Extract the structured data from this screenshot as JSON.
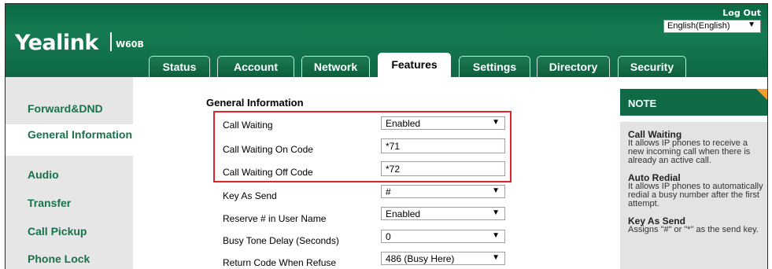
{
  "header": {
    "brand": "Yealink",
    "model": "W60B",
    "logout": "Log Out",
    "language": "English(English)"
  },
  "tabs": [
    {
      "label": "Status"
    },
    {
      "label": "Account"
    },
    {
      "label": "Network"
    },
    {
      "label": "Features"
    },
    {
      "label": "Settings"
    },
    {
      "label": "Directory"
    },
    {
      "label": "Security"
    }
  ],
  "sidebar": {
    "items": [
      {
        "label": "Forward&DND"
      },
      {
        "label": "General Information"
      },
      {
        "label": "Audio"
      },
      {
        "label": "Transfer"
      },
      {
        "label": "Call Pickup"
      },
      {
        "label": "Phone Lock"
      }
    ]
  },
  "main": {
    "section_title": "General Information",
    "rows": [
      {
        "label": "Call Waiting",
        "value": "Enabled",
        "type": "select"
      },
      {
        "label": "Call Waiting On Code",
        "value": "*71",
        "type": "input"
      },
      {
        "label": "Call Waiting Off Code",
        "value": "*72",
        "type": "input"
      },
      {
        "label": "Key As Send",
        "value": "#",
        "type": "select"
      },
      {
        "label": "Reserve # in User Name",
        "value": "Enabled",
        "type": "select"
      },
      {
        "label": "Busy Tone Delay (Seconds)",
        "value": "0",
        "type": "select"
      },
      {
        "label": "Return Code When Refuse",
        "value": "486 (Busy Here)",
        "type": "select"
      }
    ]
  },
  "note": {
    "title": "NOTE",
    "sections": [
      {
        "heading": "Call Waiting",
        "text": "It allows IP phones to receive a new incoming call when there is already an active call."
      },
      {
        "heading": "Auto Redial",
        "text": "It allows IP phones to automatically redial a busy number after the first attempt."
      },
      {
        "heading": "Key As Send",
        "text": "Assigns \"#\" or \"*\" as the send key."
      }
    ]
  },
  "colors": {
    "header_green": "#0f6a45",
    "link_green": "#18724a",
    "highlight_red": "#e0242d",
    "note_corner_orange": "#f39c2a"
  },
  "icons": {
    "dropdown": "down-triangle"
  }
}
